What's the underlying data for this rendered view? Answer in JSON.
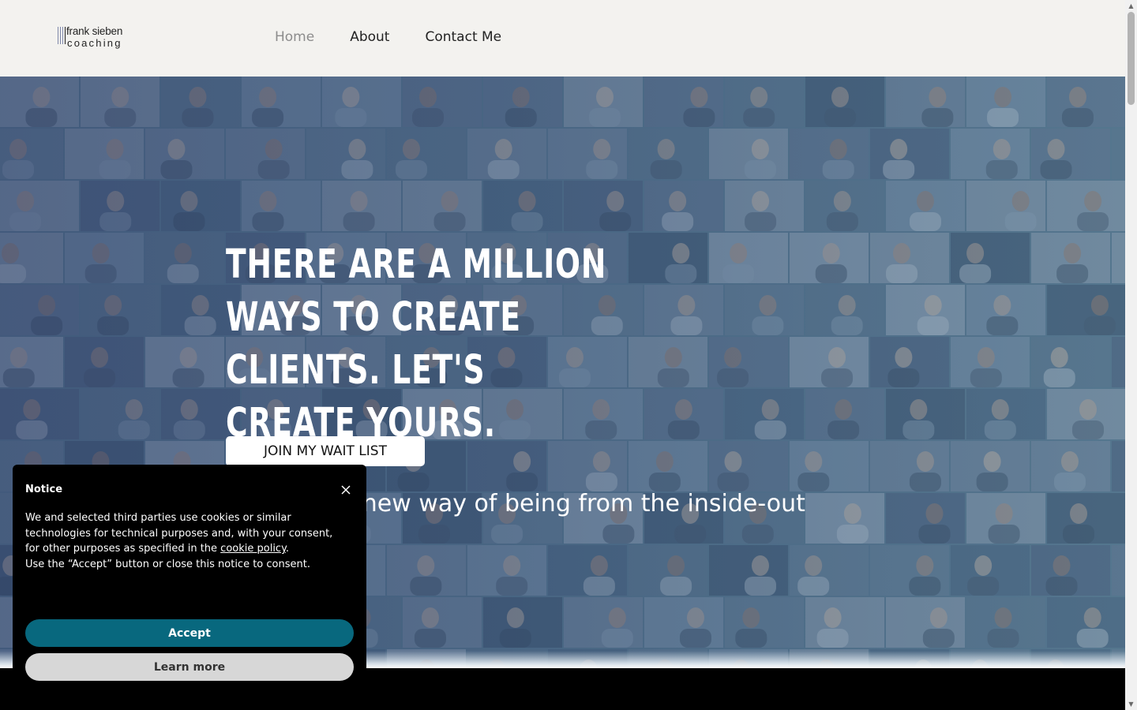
{
  "header": {
    "logo": {
      "name": "frank sieben",
      "sub": "coaching"
    },
    "nav": [
      {
        "label": "Home",
        "active": true
      },
      {
        "label": "About",
        "active": false
      },
      {
        "label": "Contact Me",
        "active": false
      }
    ]
  },
  "hero": {
    "headline": "There are a million ways to create clients. Let's create yours.",
    "cta_label": "JOIN MY WAIT LIST",
    "tagline": "Step into a new way of being from the inside-out"
  },
  "notice": {
    "title": "Notice",
    "text_before_link": "We and selected third parties use cookies or similar technologies for technical purposes and, with your consent, for other purposes as specified in the ",
    "link_text": "cookie policy",
    "text_after_link": ".",
    "text_second": "Use the “Accept” button or close this notice to consent.",
    "accept_label": "Accept",
    "learn_more_label": "Learn more"
  },
  "colors": {
    "header_bg": "#f3f2ef",
    "accent": "#08687e",
    "nav_active": "#8c8c8c"
  },
  "icons": {
    "close": "close-icon",
    "scroll_up": "scroll-up-arrow",
    "scroll_down": "scroll-down-arrow"
  }
}
